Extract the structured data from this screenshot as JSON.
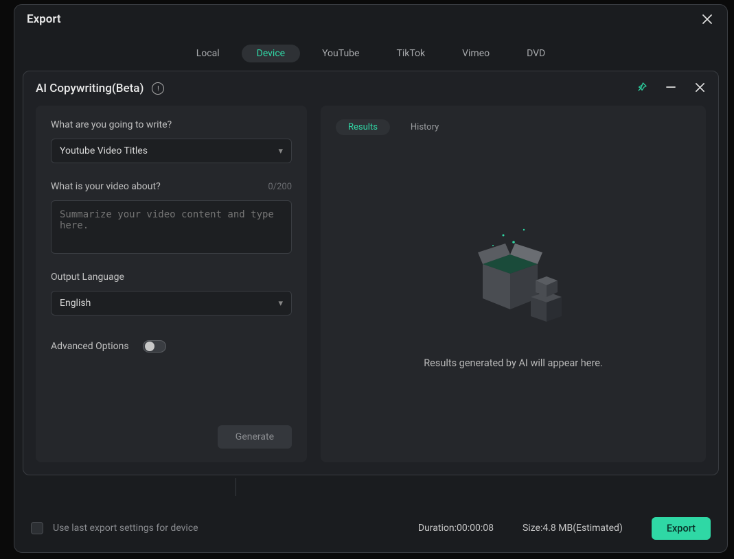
{
  "modal": {
    "title": "Export",
    "tabs": [
      {
        "label": "Local",
        "active": false
      },
      {
        "label": "Device",
        "active": true
      },
      {
        "label": "YouTube",
        "active": false
      },
      {
        "label": "TikTok",
        "active": false
      },
      {
        "label": "Vimeo",
        "active": false
      },
      {
        "label": "DVD",
        "active": false
      }
    ]
  },
  "ai_panel": {
    "title": "AI Copywriting(Beta)",
    "write_prompt_label": "What are you going to write?",
    "write_type_selected": "Youtube Video Titles",
    "about_label": "What is your video about?",
    "about_counter": "0/200",
    "about_placeholder": "Summarize your video content and type here.",
    "output_lang_label": "Output Language",
    "output_lang_selected": "English",
    "advanced_label": "Advanced Options",
    "generate_label": "Generate",
    "results_tab": "Results",
    "history_tab": "History",
    "empty_text": "Results generated by AI will appear here."
  },
  "footer": {
    "use_last_label": "Use last export settings for device",
    "duration_label": "Duration:",
    "duration_value": "00:00:08",
    "size_label": "Size:",
    "size_value": "4.8 MB(Estimated)",
    "export_label": "Export"
  }
}
